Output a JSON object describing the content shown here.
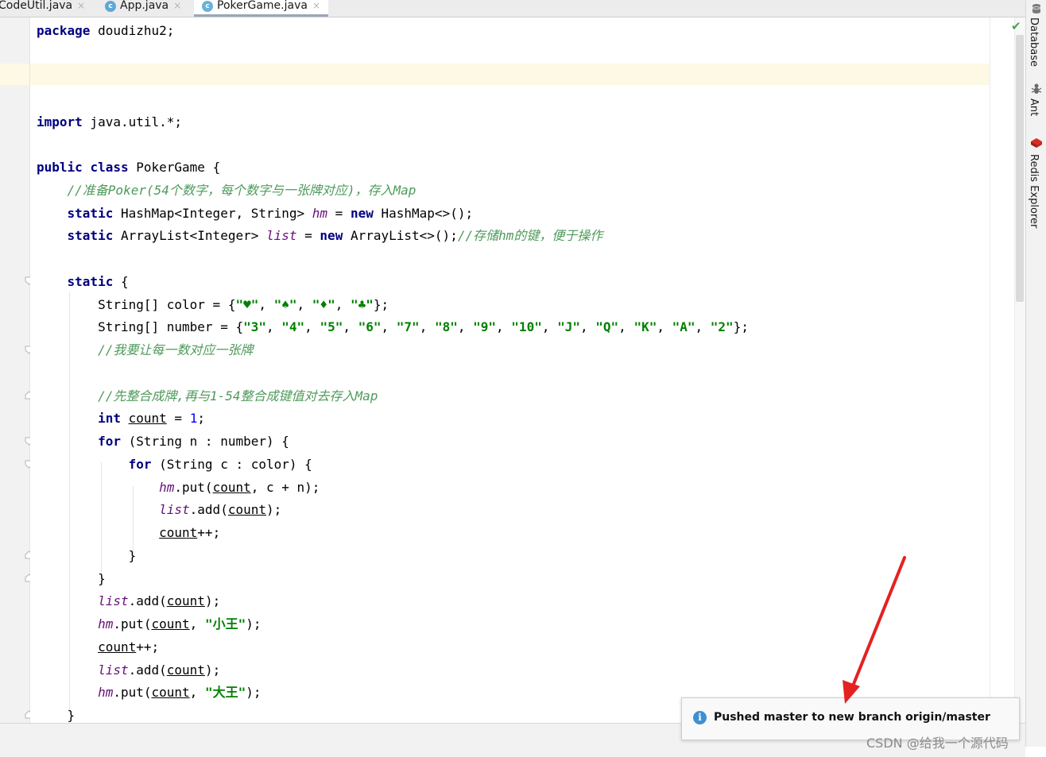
{
  "tabs": [
    {
      "label": "CodeUtil.java",
      "close": "×"
    },
    {
      "label": "App.java",
      "icon_glyph": "c",
      "close": "×"
    },
    {
      "label": "PokerGame.java",
      "icon_glyph": "c",
      "close": "×",
      "active": true
    }
  ],
  "code": {
    "l1": {
      "kw": "package",
      "rest": " doudizhu2;"
    },
    "l4": {
      "kw": "import",
      "rest": " java.util.*;"
    },
    "l6": {
      "kw1": "public",
      "kw2": "class",
      "rest": " PokerGame {"
    },
    "l7": {
      "comment": "//准备Poker(54个数字，每个数字与一张牌对应)，存入Map"
    },
    "l8": {
      "kw": "static",
      "t1": " HashMap<Integer, String> ",
      "field": "hm",
      "t2": " = ",
      "kw2": "new",
      "t3": " HashMap<>();"
    },
    "l9": {
      "kw": "static",
      "t1": " ArrayList<Integer> ",
      "field": "list",
      "t2": " = ",
      "kw2": "new",
      "t3": " ArrayList<>();",
      "comment": "//存储hm的键，便于操作"
    },
    "l11": {
      "kw": "static",
      "rest": " {"
    },
    "l12": {
      "t1": "String[] color = {",
      "s1": "\"♥\"",
      "s2": "\"♠\"",
      "s3": "\"♦\"",
      "s4": "\"♣\"",
      "end": "};",
      "sep": ", "
    },
    "l13": {
      "t1": "String[] number = {",
      "items": [
        "\"3\"",
        "\"4\"",
        "\"5\"",
        "\"6\"",
        "\"7\"",
        "\"8\"",
        "\"9\"",
        "\"10\"",
        "\"J\"",
        "\"Q\"",
        "\"K\"",
        "\"A\"",
        "\"2\""
      ],
      "end": "};"
    },
    "l14": {
      "comment": "//我要让每一数对应一张牌"
    },
    "l16": {
      "comment": "//先整合成牌,再与1-54整合成键值对去存入Map"
    },
    "l17": {
      "kw": "int",
      "var": "count",
      "t1": " = ",
      "num": "1",
      "t2": ";"
    },
    "l18": {
      "kw": "for",
      "rest": " (String n : number) {"
    },
    "l19": {
      "kw": "for",
      "rest": " (String c : color) {"
    },
    "l20": {
      "field": "hm",
      "t1": ".put(",
      "var": "count",
      "t2": ", c + n);"
    },
    "l21": {
      "field": "list",
      "t1": ".add(",
      "var": "count",
      "t2": ");"
    },
    "l22": {
      "var": "count",
      "t1": "++;"
    },
    "l23": {
      "t1": "}"
    },
    "l24": {
      "t1": "}"
    },
    "l25": {
      "field": "list",
      "t1": ".add(",
      "var": "count",
      "t2": ");"
    },
    "l26": {
      "field": "hm",
      "t1": ".put(",
      "var": "count",
      "t2": ", ",
      "str": "\"小王\"",
      "t3": ");"
    },
    "l27": {
      "var": "count",
      "t1": "++;"
    },
    "l28": {
      "field": "list",
      "t1": ".add(",
      "var": "count",
      "t2": ");"
    },
    "l29": {
      "field": "hm",
      "t1": ".put(",
      "var": "count",
      "t2": ", ",
      "str": "\"大王\"",
      "t3": ");"
    },
    "l30": {
      "t1": "}"
    }
  },
  "sidebar": {
    "database": "Database",
    "ant": "Ant",
    "redis": "Redis Explorer"
  },
  "notification": {
    "message": "Pushed master to new branch origin/master",
    "icon": "info-icon"
  },
  "watermark": "CSDN @给我一个源代码",
  "colors": {
    "keyword": "#000080",
    "field": "#660e7a",
    "string": "#008000",
    "comment": "#4e9a5a",
    "number": "#0000ff",
    "arrow": "#e32222",
    "info": "#3d8fd1"
  }
}
